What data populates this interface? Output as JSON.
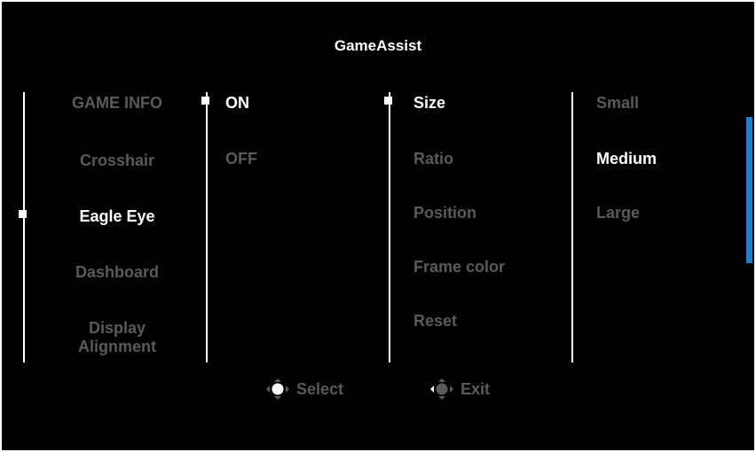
{
  "title": "GameAssist",
  "menu": {
    "items": [
      {
        "label": "GAME INFO"
      },
      {
        "label": "Crosshair"
      },
      {
        "label": "Eagle Eye"
      },
      {
        "label": "Dashboard"
      },
      {
        "label": "Display\nAlignment"
      }
    ],
    "selected": "Eagle Eye"
  },
  "toggle": {
    "options": [
      {
        "label": "ON"
      },
      {
        "label": "OFF"
      }
    ],
    "selected": "ON"
  },
  "settings": {
    "items": [
      {
        "label": "Size"
      },
      {
        "label": "Ratio"
      },
      {
        "label": "Position"
      },
      {
        "label": "Frame color"
      },
      {
        "label": "Reset"
      }
    ],
    "selected": "Size"
  },
  "size_options": {
    "items": [
      {
        "label": "Small"
      },
      {
        "label": "Medium"
      },
      {
        "label": "Large"
      }
    ],
    "selected": "Medium"
  },
  "footer": {
    "select_label": "Select",
    "select_icon": "joystick-icon",
    "exit_label": "Exit",
    "exit_icon": "joystick-left-icon"
  },
  "colors": {
    "background": "#000000",
    "text_active": "#ffffff",
    "text_inactive": "#5a5a5a",
    "scrollbar": "#1e7fd0"
  }
}
